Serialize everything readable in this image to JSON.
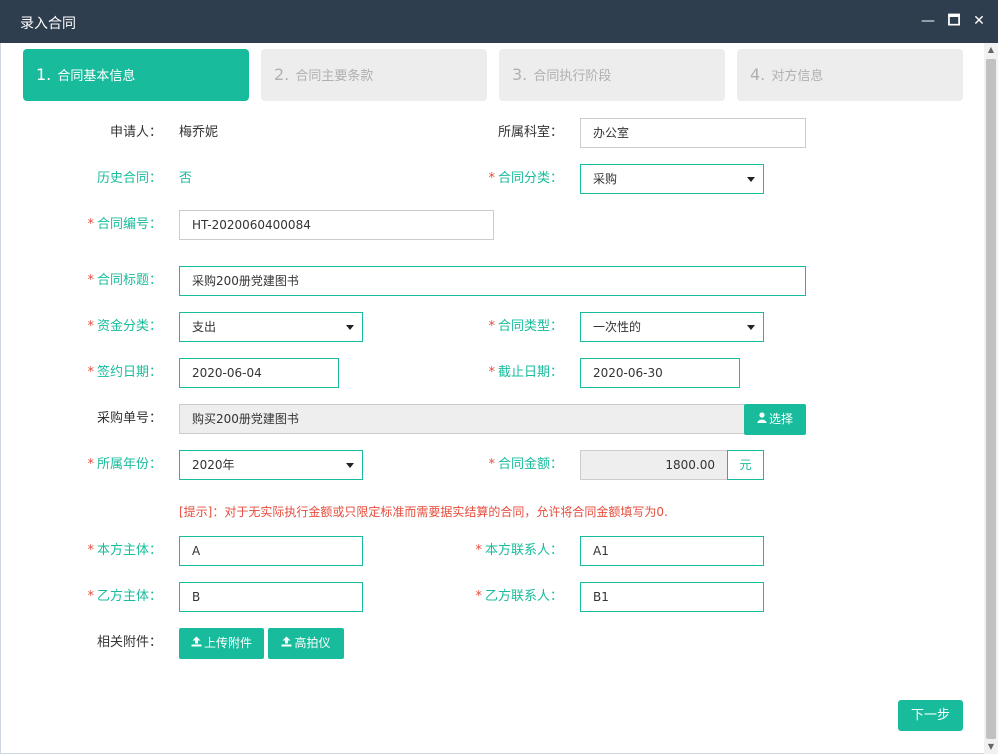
{
  "window": {
    "title": "录入合同",
    "controls": {
      "minimize": "—",
      "maximize": "🗖",
      "close": "✕"
    }
  },
  "steps": [
    {
      "num": "1.",
      "label": "合同基本信息",
      "active": true
    },
    {
      "num": "2.",
      "label": "合同主要条款",
      "active": false
    },
    {
      "num": "3.",
      "label": "合同执行阶段",
      "active": false
    },
    {
      "num": "4.",
      "label": "对方信息",
      "active": false
    }
  ],
  "form": {
    "applicant_label": "申请人：",
    "applicant_value": "梅乔妮",
    "department_label": "所属科室：",
    "department_value": "办公室",
    "history_label": "历史合同：",
    "history_value": "否",
    "category_label": "合同分类：",
    "category_value": "采购",
    "number_label": "合同编号：",
    "number_value": "HT-2020060400084",
    "title_label": "合同标题：",
    "title_value": "采购200册党建图书",
    "fund_label": "资金分类：",
    "fund_value": "支出",
    "type_label": "合同类型：",
    "type_value": "一次性的",
    "sign_date_label": "签约日期：",
    "sign_date_value": "2020-06-04",
    "end_date_label": "截止日期：",
    "end_date_value": "2020-06-30",
    "purchase_label": "采购单号：",
    "purchase_value": "购买200册党建图书",
    "select_button": "选择",
    "year_label": "所属年份：",
    "year_value": "2020年",
    "amount_label": "合同金额：",
    "amount_value": "1800.00",
    "amount_unit": "元",
    "hint": "[提示]：对于无实际执行金额或只限定标准而需要据实结算的合同，允许将合同金额填写为0.",
    "party_a_label": "本方主体：",
    "party_a_value": "A",
    "party_a_contact_label": "本方联系人：",
    "party_a_contact_value": "A1",
    "party_b_label": "乙方主体：",
    "party_b_value": "B",
    "party_b_contact_label": "乙方联系人：",
    "party_b_contact_value": "B1",
    "attachment_label": "相关附件：",
    "upload_button": "上传附件",
    "scanner_button": "高拍仪",
    "required_mark": "*"
  },
  "footer": {
    "next_button": "下一步"
  },
  "colors": {
    "accent": "#18bc9c",
    "titlebar": "#2f3e4f",
    "required": "#e74c3c",
    "step_inactive": "#ededed"
  }
}
